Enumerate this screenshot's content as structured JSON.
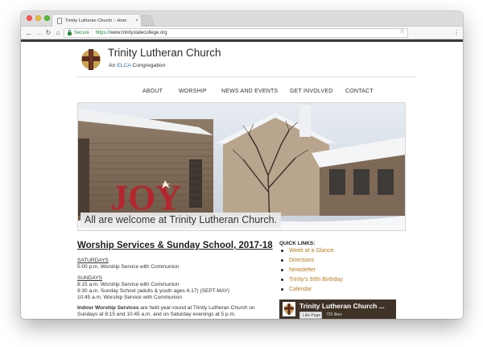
{
  "browser": {
    "tab_title": "Trinity Lutheran Church :: Hom",
    "tab_close": "×",
    "secure_label": "Secure",
    "url_scheme": "https://",
    "url_host": "www.trinitystatecollege.org",
    "icons": {
      "back": "back-arrow-icon",
      "forward": "forward-arrow-icon",
      "reload": "reload-icon",
      "home": "home-icon",
      "star": "star-icon",
      "menu": "kebab-menu-icon"
    },
    "colors": {
      "secure": "#1f8a3a",
      "close": "#fc5b57",
      "minimize": "#e5bf3c",
      "maximize": "#57c038"
    }
  },
  "site": {
    "title": "Trinity Lutheran Church",
    "tagline_prefix": "An ",
    "tagline_elca": "ELCA",
    "tagline_suffix": " Congregation",
    "nav": [
      "ABOUT",
      "WORSHIP",
      "NEWS AND EVENTS",
      "GET INVOLVED",
      "CONTACT"
    ],
    "hero": {
      "caption": "All are welcome at Trinity Lutheran Church.",
      "sign_text": "JOY"
    },
    "main": {
      "heading": "Worship Services & Sunday School, 2017-18",
      "saturdays_label": "SATURDAYS",
      "saturday_items": [
        "5:00 p.m. Worship Service with Communion"
      ],
      "sundays_label": "SUNDAYS",
      "sunday_items": [
        "8:15 a.m. Worship Service with Communion",
        "9:30 a.m. Sunday School (adults & youth ages 4-17) (SEPT-MAY)",
        "10:45 a.m. Worship Service with Communion"
      ],
      "indoor_bold": "Indoor Worship Services",
      "indoor_line1": " are held year-round at Trinity Lutheran Church on",
      "indoor_line2": "Sundays at 8:15 and 10:45 a.m. and on Saturday evenings at 5 p.m."
    },
    "quick_links": {
      "title": "QUICK LINKS:",
      "items": [
        "Week at a Glance",
        "Directions",
        "Newsletter",
        "Trinity's 50th Birthday",
        "Calendar"
      ]
    },
    "facebook": {
      "title": "Trinity Lutheran Church ...",
      "like_label": "Like Page",
      "likes": "725 likes"
    },
    "colors": {
      "link": "#c77a16",
      "elca": "#2a6ebd",
      "text": "#333333"
    }
  }
}
